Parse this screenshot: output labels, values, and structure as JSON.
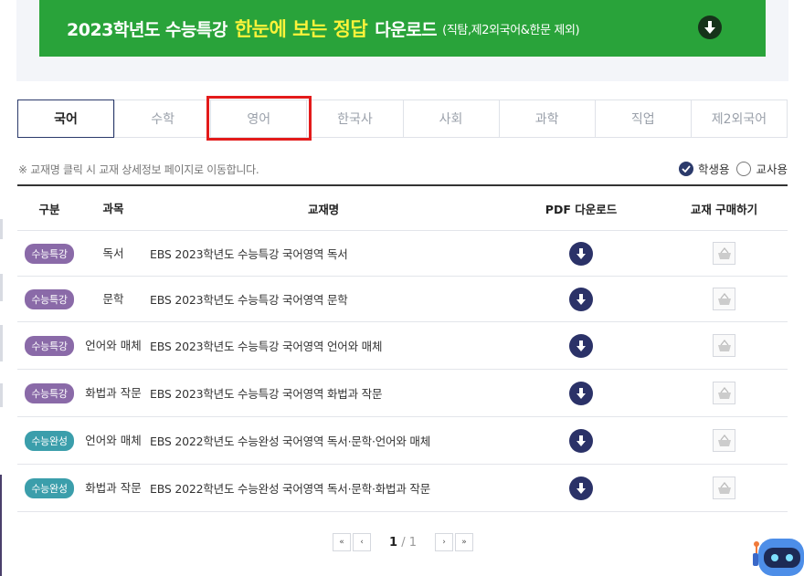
{
  "banner": {
    "part1": "2023학년도 수능특강",
    "part2": "한눈에 보는 정답",
    "part3": "다운로드",
    "part4": "(직탐,제2외국어&한문 제외)",
    "icon": "download-arrow-icon",
    "color": "#29a33a",
    "highlight_color": "#fbf33a"
  },
  "tabs": [
    {
      "label": "국어",
      "active": true
    },
    {
      "label": "수학",
      "active": false
    },
    {
      "label": "영어",
      "active": false
    },
    {
      "label": "한국사",
      "active": false
    },
    {
      "label": "사회",
      "active": false
    },
    {
      "label": "과학",
      "active": false
    },
    {
      "label": "직업",
      "active": false
    },
    {
      "label": "제2외국어",
      "active": false
    }
  ],
  "notice": "※ 교재명 클릭 시 교재 상세정보 페이지로 이동합니다.",
  "radio": {
    "student": "학생용",
    "teacher": "교사용",
    "selected": "학생용"
  },
  "table": {
    "headers": {
      "category": "구분",
      "subject": "과목",
      "title": "교재명",
      "pdf": "PDF 다운로드",
      "buy": "교재 구매하기"
    },
    "rows": [
      {
        "category": "수능특강",
        "subject": "독서",
        "title": "EBS 2023학년도 수능특강 국어영역 독서"
      },
      {
        "category": "수능특강",
        "subject": "문학",
        "title": "EBS 2023학년도 수능특강 국어영역 문학"
      },
      {
        "category": "수능특강",
        "subject": "언어와 매체",
        "title": "EBS 2023학년도 수능특강 국어영역 언어와 매체"
      },
      {
        "category": "수능특강",
        "subject": "화법과 작문",
        "title": "EBS 2023학년도 수능특강 국어영역 화법과 작문"
      },
      {
        "category": "수능완성",
        "subject": "언어와 매체",
        "title": "EBS 2022학년도 수능완성 국어영역 독서·문학·언어와 매체"
      },
      {
        "category": "수능완성",
        "subject": "화법과 작문",
        "title": "EBS 2022학년도 수능완성 국어영역 독서·문학·화법과 작문"
      }
    ]
  },
  "pagination": {
    "current": "1",
    "separator": "/",
    "total": "1"
  },
  "colors": {
    "navy": "#2b3268",
    "badge_purple": "#8a6aa8",
    "badge_teal": "#3b9eab",
    "highlight_red": "#e31b1b"
  }
}
